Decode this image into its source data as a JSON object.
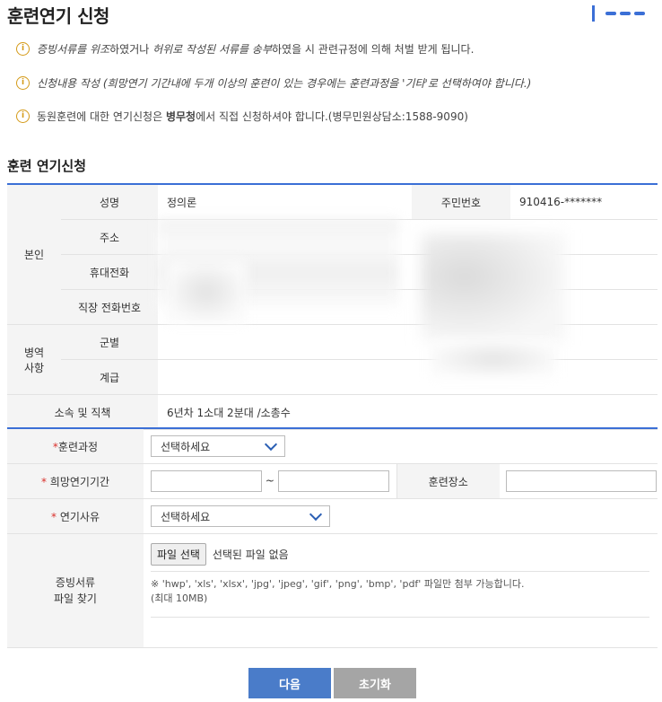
{
  "header": {
    "title": "훈련연기 신청"
  },
  "notices": [
    {
      "parts": [
        {
          "t": "증빙서류를 ",
          "s": "em"
        },
        {
          "t": "위조",
          "s": "em"
        },
        {
          "t": "하였거나 ",
          "s": ""
        },
        {
          "t": "허위로 작성된 서류를 송부",
          "s": "em"
        },
        {
          "t": "하였을 시 관련규정에 의해 처벌 받게 됩니다.",
          "s": ""
        }
      ]
    },
    {
      "parts": [
        {
          "t": "신청내용 작성 (희망연기 기간내에 두개 이상의 훈련이 있는 경우에는 훈련과정을 '기타'로 선택하여야 합니다.)",
          "s": "em"
        }
      ]
    },
    {
      "parts": [
        {
          "t": "동원훈련에 대한 연기신청은 ",
          "s": ""
        },
        {
          "t": "병무청",
          "s": "b"
        },
        {
          "t": "에서 직접 신청하셔야 합니다.(병무민원상담소:1588-9090)",
          "s": ""
        }
      ]
    }
  ],
  "section_title": "훈련 연기신청",
  "person": {
    "group_label": "본인",
    "name_label": "성명",
    "name_value": "정의론",
    "rrn_label": "주민번호",
    "rrn_value": "910416-*******",
    "address_label": "주소",
    "mobile_label": "휴대전화",
    "work_phone_label": "직장 전화번호"
  },
  "military": {
    "group_label": "병역\n사항",
    "branch_label": "군별",
    "rank_label": "계급"
  },
  "unit": {
    "label": "소속 및 직책",
    "value": "6년차 1소대 2분대 /소총수"
  },
  "form": {
    "course_label": "훈련과정",
    "course_select": "선택하세요",
    "period_label": "희망연기기간",
    "period_sep": "~",
    "place_label": "훈련장소",
    "reason_label": "연기사유",
    "reason_select": "선택하세요",
    "file_label": "증빙서류\n파일 찾기",
    "file_button": "파일 선택",
    "file_status": "선택된 파일 없음",
    "file_hint1": "※ 'hwp', 'xls', 'xlsx', 'jpg', 'jpeg', 'gif', 'png', 'bmp', 'pdf' 파일만 첨부 가능합니다.",
    "file_hint2": "(최대 10MB)",
    "required_mark": "*"
  },
  "buttons": {
    "next": "다음",
    "reset": "초기화"
  }
}
